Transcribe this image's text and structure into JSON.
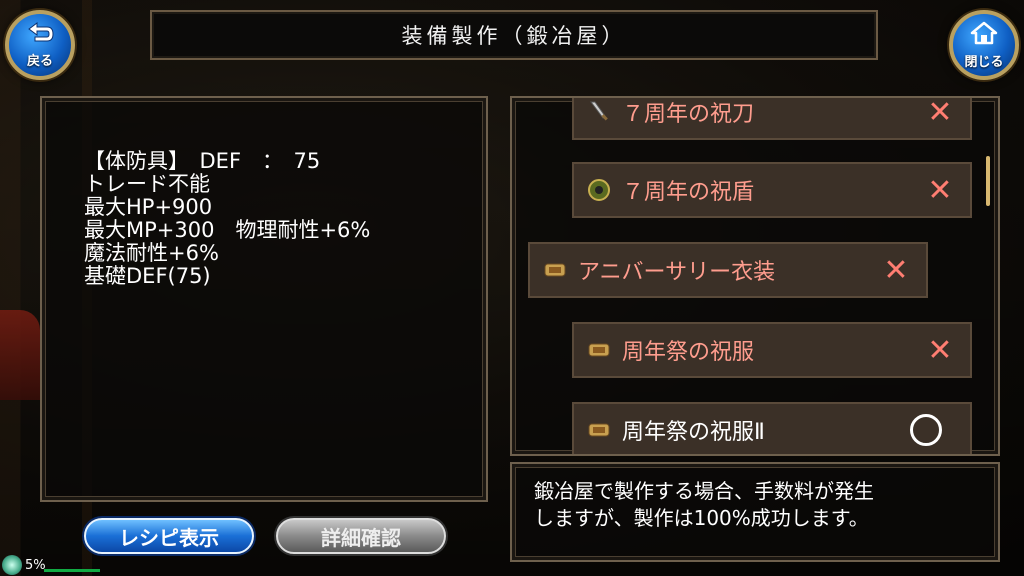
{
  "header": {
    "title": "装備製作（鍛冶屋）",
    "back_label": "戻る",
    "close_label": "閉じる"
  },
  "detail": {
    "lines": [
      "【体防具】　DEF　：　75",
      "トレード不能",
      "最大HP+900",
      "最大MP+300　物理耐性+6%",
      "魔法耐性+6%",
      "基礎DEF(75)"
    ]
  },
  "recipes": [
    {
      "name": "７周年の祝刀",
      "icon": "sword-icon",
      "craftable": false,
      "mark": "✕"
    },
    {
      "name": "７周年の祝盾",
      "icon": "shield-icon",
      "craftable": false,
      "mark": "✕"
    },
    {
      "name": "アニバーサリー衣装",
      "icon": "armor-icon",
      "craftable": false,
      "mark": "✕"
    },
    {
      "name": "周年祭の祝服",
      "icon": "armor-icon",
      "craftable": false,
      "mark": "✕"
    },
    {
      "name": "周年祭の祝服Ⅱ",
      "icon": "armor-icon",
      "craftable": true,
      "mark": "○"
    }
  ],
  "message": {
    "line1": "鍛冶屋で製作する場合、手数料が発生",
    "line2": "しますが、製作は100%成功します。"
  },
  "buttons": {
    "recipe_label": "レシピ表示",
    "detail_label": "詳細確認"
  },
  "status": {
    "percent": "5%"
  },
  "colors": {
    "unavailable": "#ff9d8e",
    "available": "#ffffff",
    "accent_blue": "#1a6fd6"
  }
}
